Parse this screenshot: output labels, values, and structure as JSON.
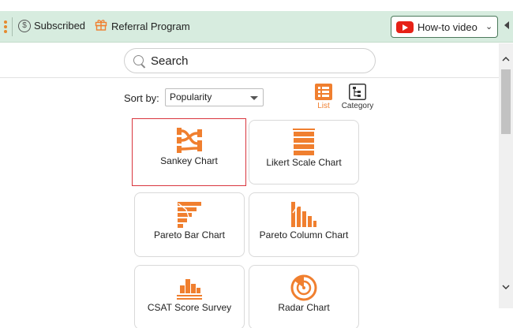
{
  "toolbar": {
    "subscribed_label": "Subscribed",
    "subscribed_icon": "dollar-circle-icon",
    "referral_label": "Referral Program",
    "referral_icon": "gift-icon",
    "howto_label": "How-to video",
    "howto_icon": "youtube-icon"
  },
  "search": {
    "placeholder": "Search",
    "value": ""
  },
  "sort": {
    "label": "Sort by:",
    "selected": "Popularity"
  },
  "views": [
    {
      "label": "List",
      "icon": "list-icon",
      "active": true
    },
    {
      "label": "Category",
      "icon": "category-tree-icon",
      "active": false
    }
  ],
  "charts": [
    {
      "label": "Sankey Chart",
      "icon": "sankey-chart-icon",
      "selected": true
    },
    {
      "label": "Likert Scale Chart",
      "icon": "likert-scale-chart-icon",
      "selected": false
    },
    {
      "label": "Pareto Bar Chart",
      "icon": "pareto-bar-chart-icon",
      "selected": false
    },
    {
      "label": "Pareto Column Chart",
      "icon": "pareto-column-chart-icon",
      "selected": false
    },
    {
      "label": "CSAT Score Survey",
      "icon": "csat-score-survey-icon",
      "selected": false
    },
    {
      "label": "Radar Chart",
      "icon": "radar-chart-icon",
      "selected": false
    }
  ],
  "colors": {
    "accent": "#f07f2f",
    "toolbar_bg": "#d7ecdf",
    "selection": "#d9363e",
    "youtube": "#e62117"
  }
}
